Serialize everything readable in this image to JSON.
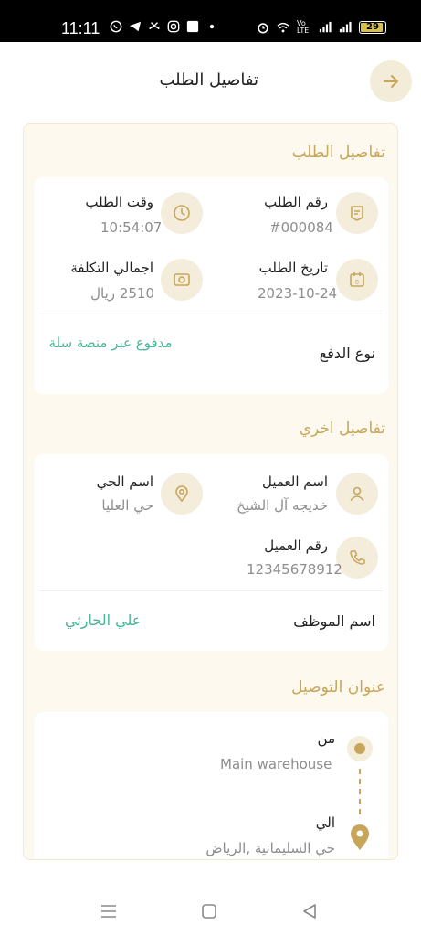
{
  "status_bar": {
    "time": "11:11",
    "battery": "29",
    "network": "Vo LTE"
  },
  "header": {
    "title": "تفاصيل الطلب"
  },
  "order_details": {
    "section_title": "تفاصيل الطلب",
    "order_number_label": "رقم الطلب",
    "order_number": "#000084",
    "order_time_label": "وقت الطلب",
    "order_time": "10:54:07",
    "order_date_label": "تاريخ الطلب",
    "order_date": "2023-10-24",
    "total_cost_label": "اجمالي التكلفة",
    "total_cost": "2510 ريال",
    "payment_type_label": "نوع الدفع",
    "payment_type_value": "مدفوع عبر منصة سلة"
  },
  "other_details": {
    "section_title": "تفاصيل اخري",
    "customer_name_label": "اسم العميل",
    "customer_name": "خديجه آل الشيخ",
    "district_label": "اسم الحي",
    "district": "حي العليا",
    "customer_phone_label": "رقم العميل",
    "customer_phone": "12345678912",
    "employee_label": "اسم الموظف",
    "employee": "علي الحارثي"
  },
  "delivery": {
    "section_title": "عنوان التوصيل",
    "from_label": "من",
    "from_value": "Main warehouse",
    "to_label": "الي",
    "to_value": "حي السليمانية ,الرياض"
  },
  "colors": {
    "accent": "#c7a65a",
    "icon_bg": "#f4eddc",
    "card_bg": "#fdf9ee",
    "green": "#48b59a"
  },
  "icons": [
    "arrow-right-icon",
    "receipt-icon",
    "clock-icon",
    "calendar-icon",
    "cash-icon",
    "user-icon",
    "location-pin-icon",
    "phone-icon",
    "origin-dot-icon",
    "destination-pin-icon"
  ]
}
